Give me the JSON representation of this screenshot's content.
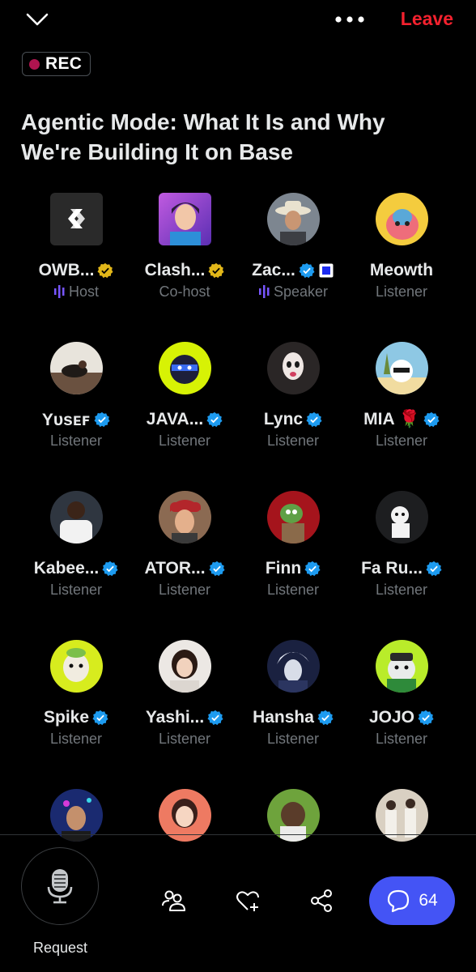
{
  "top_bar": {
    "collapse_icon": "chevron-down-icon",
    "more_icon": "more-horizontal-icon",
    "leave_label": "Leave",
    "leave_color": "#f4212e"
  },
  "rec": {
    "label": "REC",
    "dot_color": "#b1144f"
  },
  "space_title": "Agentic Mode: What It Is and Why We're Building It on Base",
  "participants": [
    {
      "name": "OWB...",
      "role": "Host",
      "badge": "gold",
      "speaking": true
    },
    {
      "name": "Clash...",
      "role": "Co-host",
      "badge": "gold",
      "speaking": false
    },
    {
      "name": "Zac...",
      "role": "Speaker",
      "badge": "blue",
      "speaking": true,
      "extra": "◻"
    },
    {
      "name": "Meowth",
      "role": "Listener",
      "badge": "none",
      "speaking": false
    },
    {
      "name": "Yᴜsᴇꜰ",
      "role": "Listener",
      "badge": "blue",
      "speaking": false
    },
    {
      "name": "JAVA...",
      "role": "Listener",
      "badge": "blue",
      "speaking": false
    },
    {
      "name": "Lync",
      "role": "Listener",
      "badge": "blue",
      "speaking": false
    },
    {
      "name": "MIA 🌹",
      "role": "Listener",
      "badge": "blue",
      "speaking": false
    },
    {
      "name": "Kabee...",
      "role": "Listener",
      "badge": "blue",
      "speaking": false
    },
    {
      "name": "ATOR...",
      "role": "Listener",
      "badge": "blue",
      "speaking": false
    },
    {
      "name": "Finn",
      "role": "Listener",
      "badge": "blue",
      "speaking": false
    },
    {
      "name": "Fa Ru...",
      "role": "Listener",
      "badge": "blue",
      "speaking": false
    },
    {
      "name": "Spike",
      "role": "Listener",
      "badge": "blue",
      "speaking": false
    },
    {
      "name": "Yashi...",
      "role": "Listener",
      "badge": "blue",
      "speaking": false
    },
    {
      "name": "Hansha",
      "role": "Listener",
      "badge": "blue",
      "speaking": false
    },
    {
      "name": "JOJO",
      "role": "Listener",
      "badge": "blue",
      "speaking": false
    }
  ],
  "bottom_bar": {
    "request_label": "Request",
    "mic_icon": "microphone-icon",
    "people_icon": "people-icon",
    "heart_icon": "heart-plus-icon",
    "share_icon": "share-icon",
    "chat_icon": "chat-bubble-icon",
    "chat_count": "64",
    "accent": "#4454f5"
  },
  "colors": {
    "verified_blue": "#1d9bf0",
    "verified_gold": "#e2b719",
    "speaking_purple": "#7856ff",
    "muted_text": "#71767b"
  }
}
